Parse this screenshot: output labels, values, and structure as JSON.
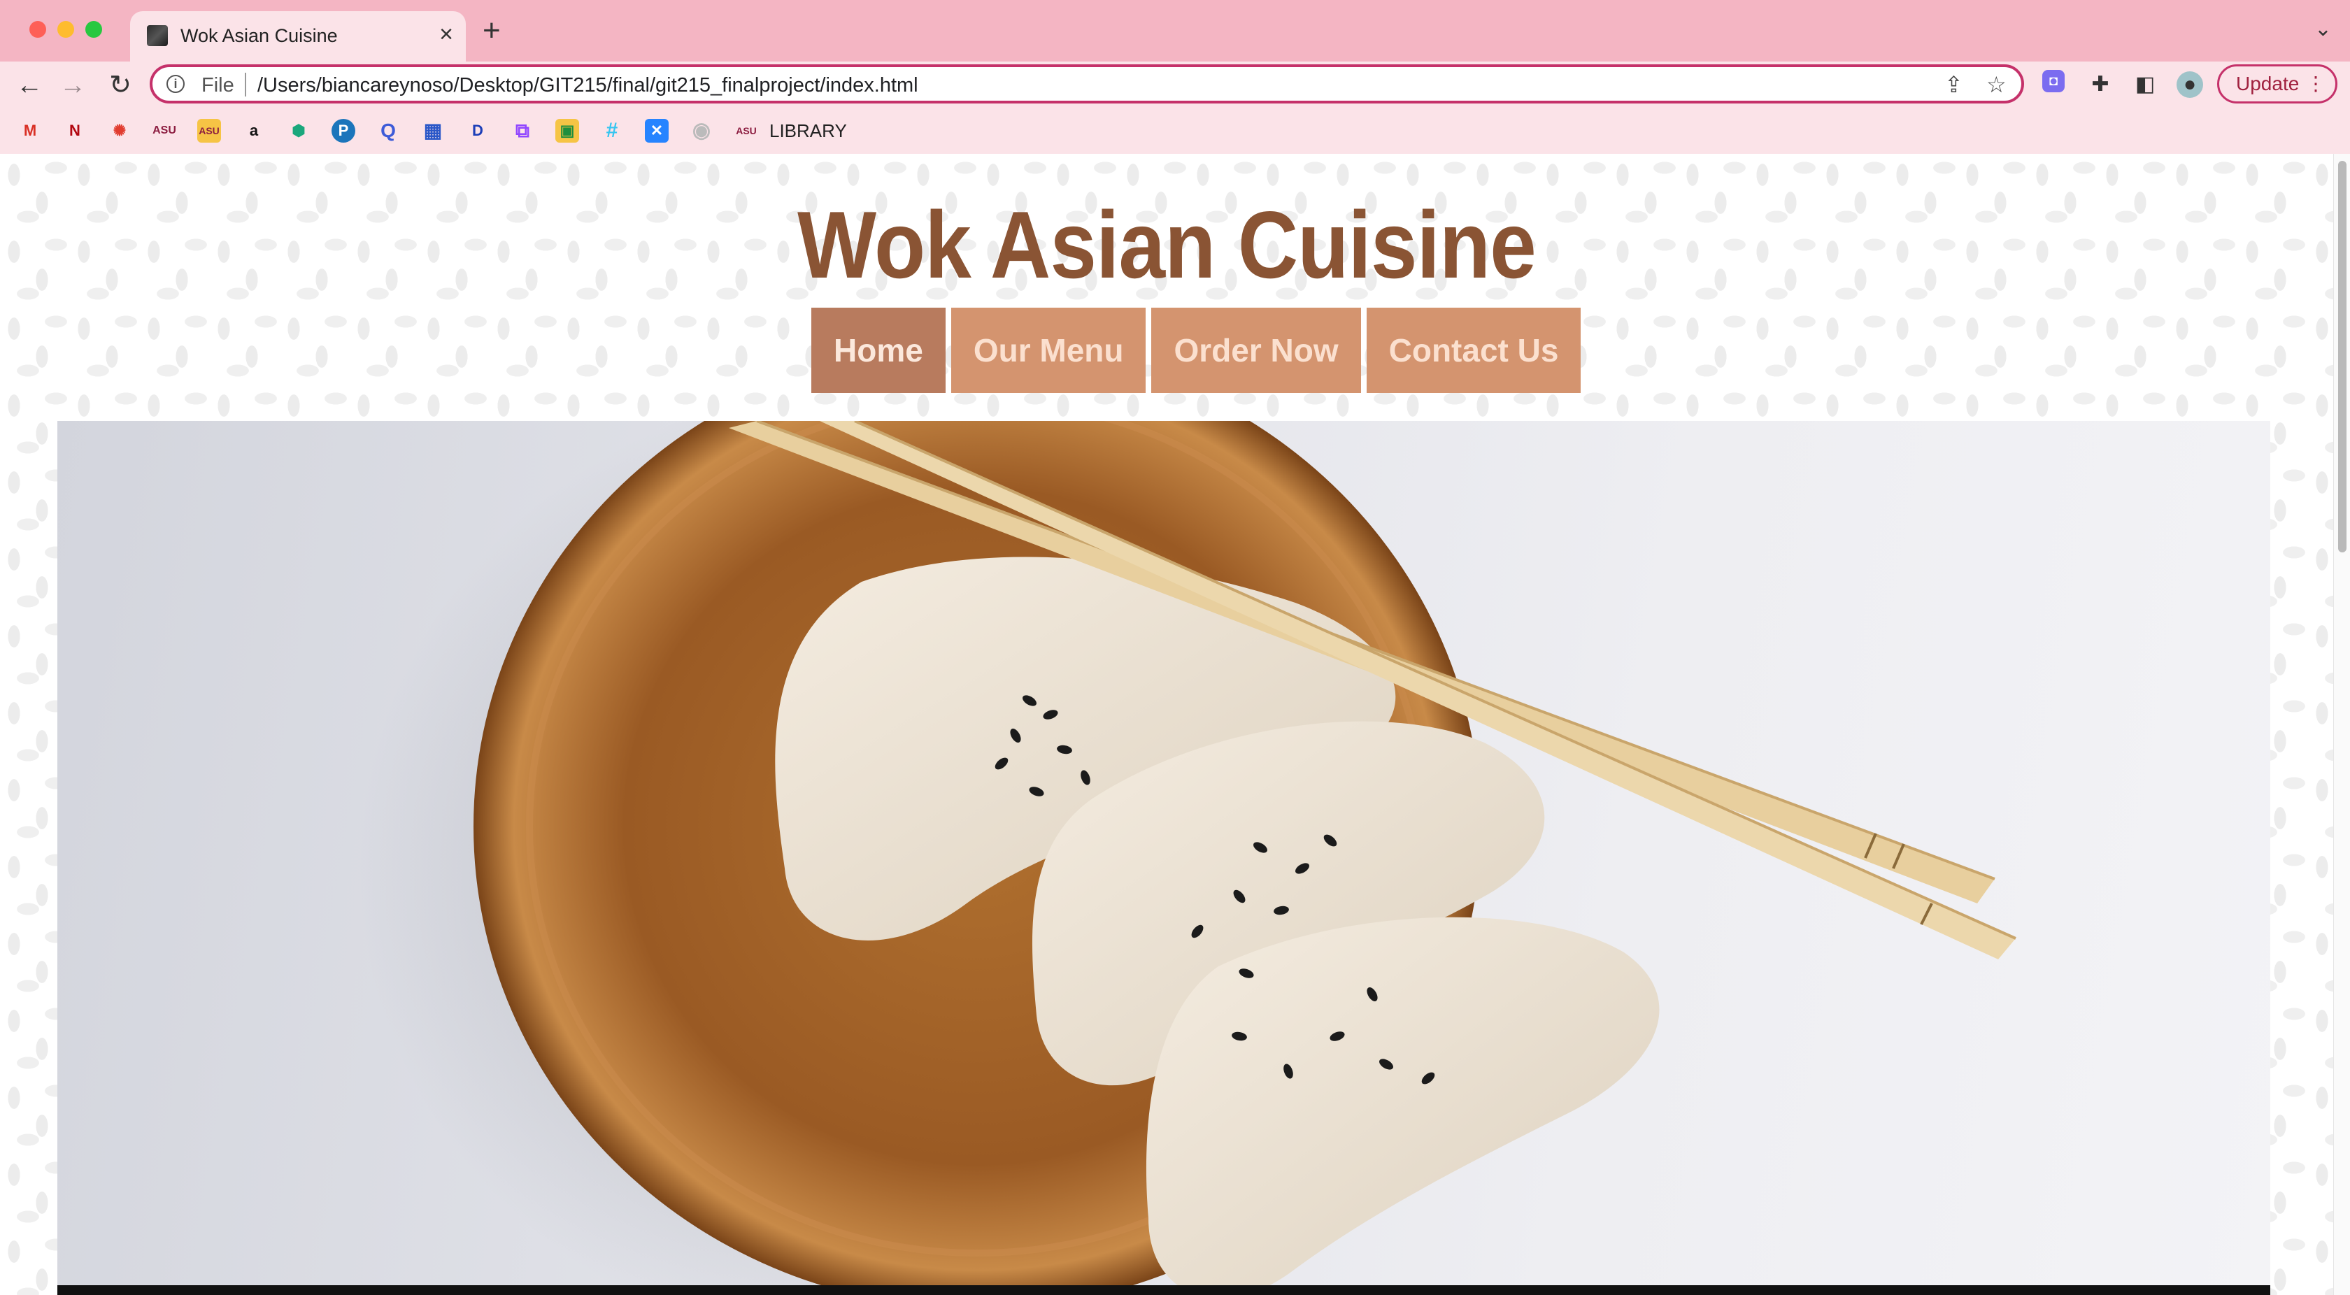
{
  "browser": {
    "tab_title": "Wok Asian Cuisine",
    "url_scheme": "File",
    "url": "/Users/biancareynoso/Desktop/GIT215/final/git215_finalproject/index.html",
    "update_label": "Update",
    "bookmarks": [
      {
        "icon": "gmail-icon",
        "glyph": "M",
        "color": "#d93025"
      },
      {
        "icon": "netflix-icon",
        "glyph": "N",
        "color": "#b20710"
      },
      {
        "icon": "canvas-icon",
        "glyph": "✺",
        "color": "#e13c2f"
      },
      {
        "icon": "asu-icon",
        "glyph": "ASU",
        "color": "#8c1d40"
      },
      {
        "icon": "asu-icon",
        "glyph": "ASU",
        "color": "#8c1d40"
      },
      {
        "icon": "amazon-icon",
        "glyph": "a",
        "color": "#111111"
      },
      {
        "icon": "shield-icon",
        "glyph": "⬢",
        "color": "#1aa77c"
      },
      {
        "icon": "pearson-icon",
        "glyph": "P",
        "color": "#1b75bb"
      },
      {
        "icon": "q-icon",
        "glyph": "Q",
        "color": "#3d5bd8"
      },
      {
        "icon": "calendar-icon",
        "glyph": "▦",
        "color": "#2a57c8"
      },
      {
        "icon": "disney-plus-icon",
        "glyph": "D",
        "color": "#1d3fb8"
      },
      {
        "icon": "twitch-icon",
        "glyph": "⧉",
        "color": "#9146ff"
      },
      {
        "icon": "classroom-icon",
        "glyph": "▣",
        "color": "#1e8e3e"
      },
      {
        "icon": "slack-icon",
        "glyph": "#",
        "color": "#36c5f0"
      },
      {
        "icon": "confluence-icon",
        "glyph": "✕",
        "color": "#2684ff"
      },
      {
        "icon": "github-icon",
        "glyph": "◉",
        "color": "#bbbbbb"
      },
      {
        "icon": "asu-library-icon",
        "glyph": "ASU",
        "color": "#8c1d40"
      }
    ],
    "library_label": "LIBRARY"
  },
  "site": {
    "title": "Wok Asian Cuisine",
    "nav": [
      {
        "label": "Home",
        "active": true
      },
      {
        "label": "Our Menu",
        "active": false
      },
      {
        "label": "Order Now",
        "active": false
      },
      {
        "label": "Contact Us",
        "active": false
      }
    ]
  },
  "colors": {
    "title_brown": "#8a5434",
    "nav_tan": "#d4946f",
    "nav_active": "#b87b5e",
    "chrome_pink": "#f4b5c3",
    "accent_magenta": "#c5316a"
  }
}
